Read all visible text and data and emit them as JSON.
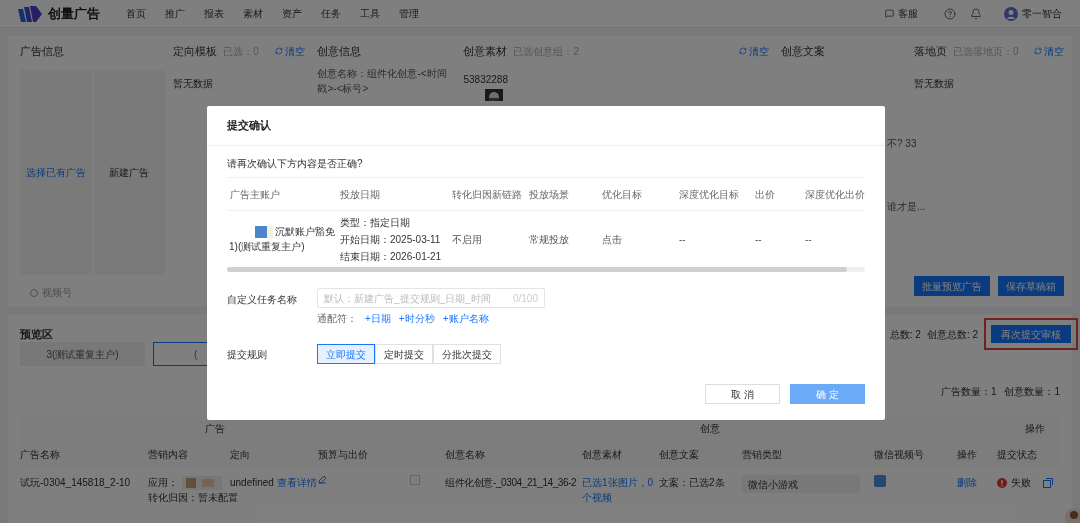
{
  "nav": {
    "brand": "创量广告",
    "items": [
      "首页",
      "推广",
      "报表",
      "素材",
      "资产",
      "任务",
      "工具",
      "管理"
    ],
    "service": "客服",
    "user": "零一智合"
  },
  "ad_info": {
    "title": "广告信息",
    "options": [
      "选择已有广告",
      "新建广告"
    ],
    "footer": "视频号"
  },
  "targeting": {
    "title": "定向模板",
    "count": "已选：0",
    "clear": "清空",
    "empty": "暂无数据"
  },
  "creative_info": {
    "title": "创意信息",
    "lines": [
      "创意名称：组件化创意-<时间戳>-<标号>"
    ]
  },
  "creative_assets": {
    "title": "创意素材",
    "count": "已选创意组：2",
    "clear": "清空",
    "asset_id": "53832288"
  },
  "creative_copy": {
    "title": "创意文案",
    "snippets": [
      "不? 33",
      "谁才是..."
    ]
  },
  "landing": {
    "title": "落地页",
    "count": "已选落地页：0",
    "clear": "清空",
    "empty": "暂无数据"
  },
  "actions": [
    "批量预览广告",
    "保存草稿箱"
  ],
  "preview": {
    "title": "预览区",
    "tabs": [
      {
        "label": "3(测试重复主户)",
        "selected": false
      },
      {
        "label": "(",
        "selected": true
      }
    ],
    "totals": [
      "总数: 2",
      "创意总数: 2"
    ],
    "resubmit": "再次提交审核",
    "counts": [
      "广告数量：1",
      "创意数量：1"
    ]
  },
  "table": {
    "groups": [
      "广告",
      "创意",
      "操作"
    ],
    "columns": [
      "广告名称",
      "营销内容",
      "定向",
      "预算与出价",
      "创意名称",
      "创意素材",
      "创意文案",
      "营销类型",
      "微信视频号",
      "操作",
      "提交状态"
    ],
    "rows": [
      {
        "name": "试玩-0304_145818_2-10",
        "app": "应用：",
        "attribution": "转化归因：暂未配置",
        "targeting": "undefined",
        "targeting_link": "查看详情",
        "checked": false,
        "creative_name": "组件化创意-_0304_21_14_36-2",
        "assets": "已选1张图片，0个视频",
        "copy": "文案：已选2条",
        "marketing_type": "微信小游戏",
        "delete": "删除",
        "status": "失败"
      }
    ]
  },
  "modal": {
    "title": "提交确认",
    "prompt": "请再次确认下方内容是否正确?",
    "columns": [
      "广告主账户",
      "投放日期",
      "转化归因新链路",
      "投放场景",
      "优化目标",
      "深度优化目标",
      "出价",
      "深度优化出价"
    ],
    "row": {
      "account": [
        "沉默账户豁免",
        "1)(测试重复主户)"
      ],
      "dates": [
        "类型：指定日期",
        "开始日期：2025-03-11",
        "结束日期：2026-01-21"
      ],
      "cells": [
        "不启用",
        "常规投放",
        "点击",
        "--",
        "--",
        "--"
      ]
    },
    "task_label": "自定义任务名称",
    "task_placeholder": "默认：新建广告_提交规则_日期_时间",
    "task_counter": "0/100",
    "wildcard_label": "通配符：",
    "wildcards": [
      "+日期",
      "+时分秒",
      "+账户名称"
    ],
    "rule_label": "提交规则",
    "rules": [
      {
        "label": "立即提交",
        "selected": true
      },
      {
        "label": "定时提交",
        "selected": false
      },
      {
        "label": "分批次提交",
        "selected": false
      }
    ],
    "cancel": "取 消",
    "ok": "确 定"
  }
}
